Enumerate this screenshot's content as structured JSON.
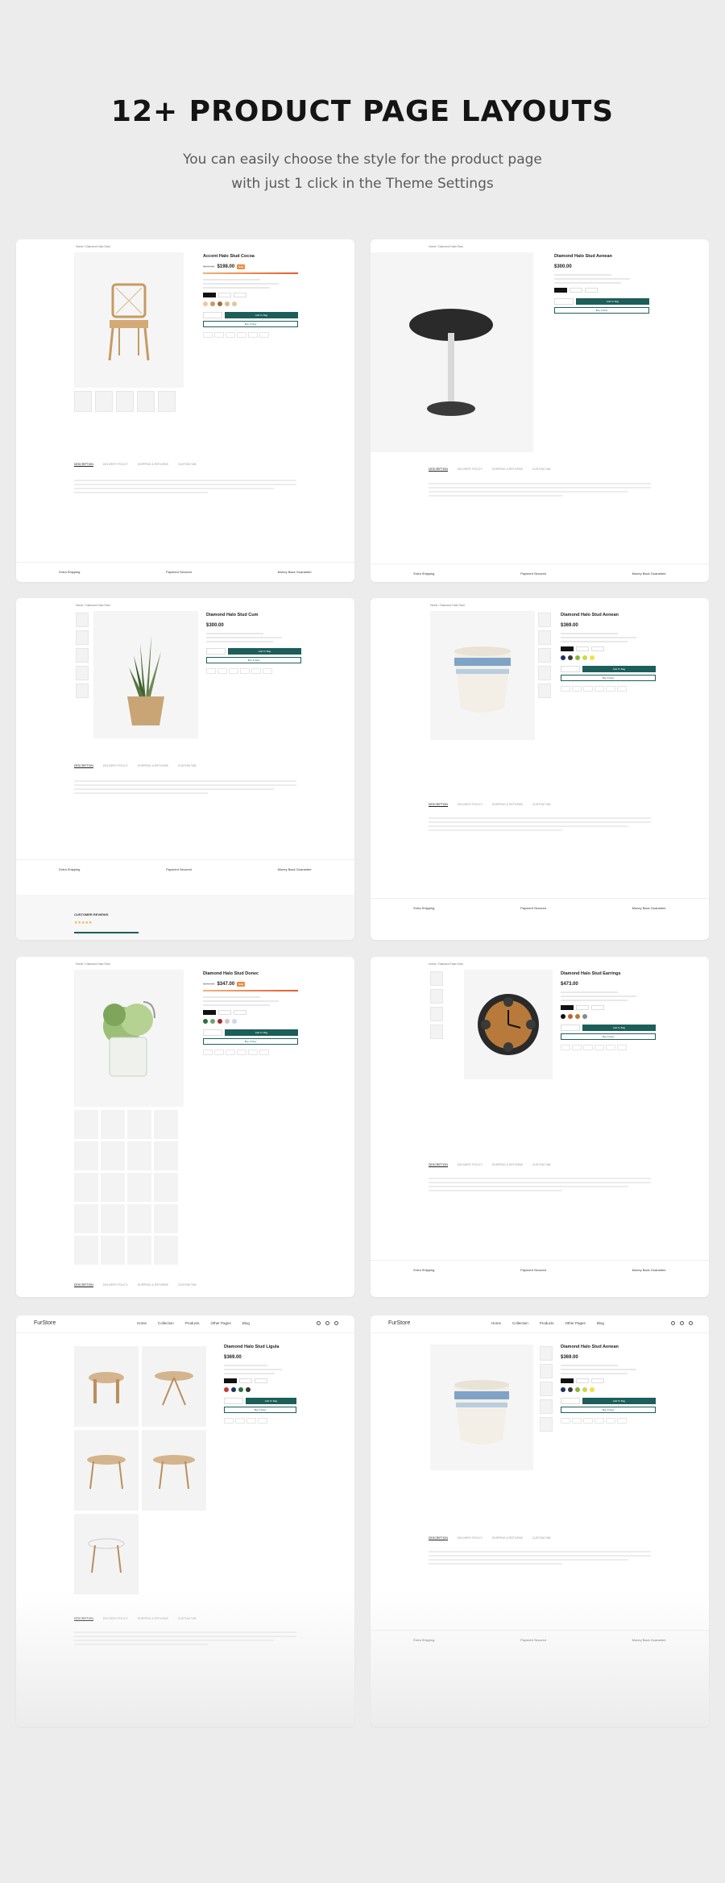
{
  "hero": {
    "title": "12+ PRODUCT PAGE LAYOUTS",
    "subtitle_line1": "You can easily choose the style for the product page",
    "subtitle_line2": "with just 1 click in the Theme Settings"
  },
  "cards": [
    {
      "title": "Accent Halo Stud Cocoa",
      "price": "$198.00",
      "old_price": "$299.00",
      "sale_tag": "Sale",
      "product": "chair"
    },
    {
      "title": "Diamond Halo Stud Aenean",
      "price": "$300.00",
      "product": "table"
    },
    {
      "title": "Diamond Halo Stud Cum",
      "price": "$300.00",
      "product": "plant",
      "reviews_label": "CUSTOMER REVIEWS"
    },
    {
      "title": "Diamond Halo Stud Aenean",
      "price": "$369.00",
      "product": "vase"
    },
    {
      "title": "Diamond Halo Stud Donec",
      "price": "$347.00",
      "old_price": "$599.00",
      "sale_tag": "Sale",
      "product": "planter"
    },
    {
      "title": "Diamond Halo Stud Earrings",
      "price": "$473.00",
      "product": "clock"
    },
    {
      "title": "Diamond Halo Stud Ligula",
      "price": "$369.00",
      "product": "table-set",
      "logo": "FurStore"
    },
    {
      "title": "Diamond Halo Stud Aenean",
      "price": "$369.00",
      "product": "vase",
      "logo": "FurStore"
    }
  ],
  "common": {
    "breadcrumb": "Home  /  Diamond Halo Stud",
    "add_to_cart": "Add To Bag",
    "buy_now": "Buy It Now",
    "tabs": [
      "DESCRIPTION",
      "DELIVERY POLICY",
      "SHIPPING & RETURNS",
      "CUSTOM TAB"
    ],
    "features": [
      "Extra Shipping",
      "Payment Secured",
      "Money Back Guarantee"
    ],
    "nav": [
      "Home",
      "Collection",
      "Products",
      "Other Pages",
      "Blog"
    ]
  },
  "colors": {
    "page_bg": "#ececec",
    "accent": "#1c5e59",
    "sale": "#f08a3c"
  }
}
